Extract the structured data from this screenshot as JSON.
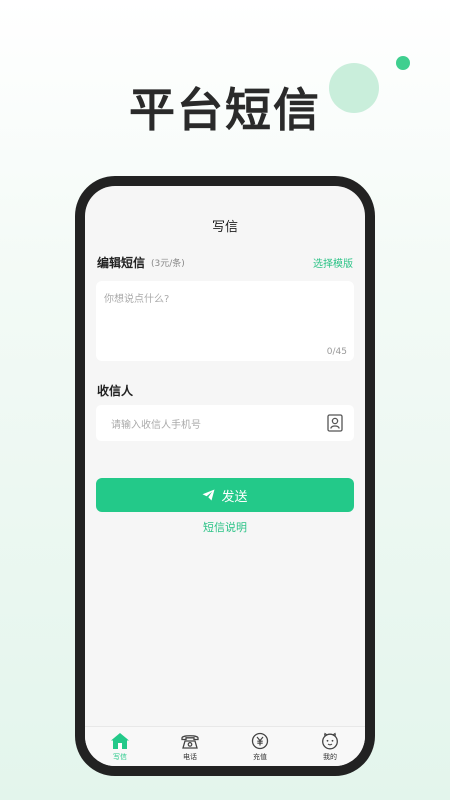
{
  "headline": "平台短信",
  "screen": {
    "nav_title": "写信",
    "message_section": {
      "title": "编辑短信",
      "price": "(3元/条)",
      "template_link": "选择模版",
      "placeholder": "你想说点什么?",
      "counter": "0/45"
    },
    "recipient_section": {
      "title": "收信人",
      "placeholder": "请输入收信人手机号",
      "icon": "contact-book-icon"
    },
    "send_button": {
      "label": "发送",
      "icon": "paper-plane-icon"
    },
    "help_link": "短信说明",
    "tabs": [
      {
        "label": "写信",
        "icon": "home-icon",
        "active": true
      },
      {
        "label": "电话",
        "icon": "telephone-icon",
        "active": false
      },
      {
        "label": "充值",
        "icon": "yuan-coin-icon",
        "active": false
      },
      {
        "label": "我的",
        "icon": "profile-face-icon",
        "active": false
      }
    ]
  },
  "colors": {
    "accent": "#23c989",
    "headline": "#2a2a2a",
    "phone_frame": "#222222"
  }
}
